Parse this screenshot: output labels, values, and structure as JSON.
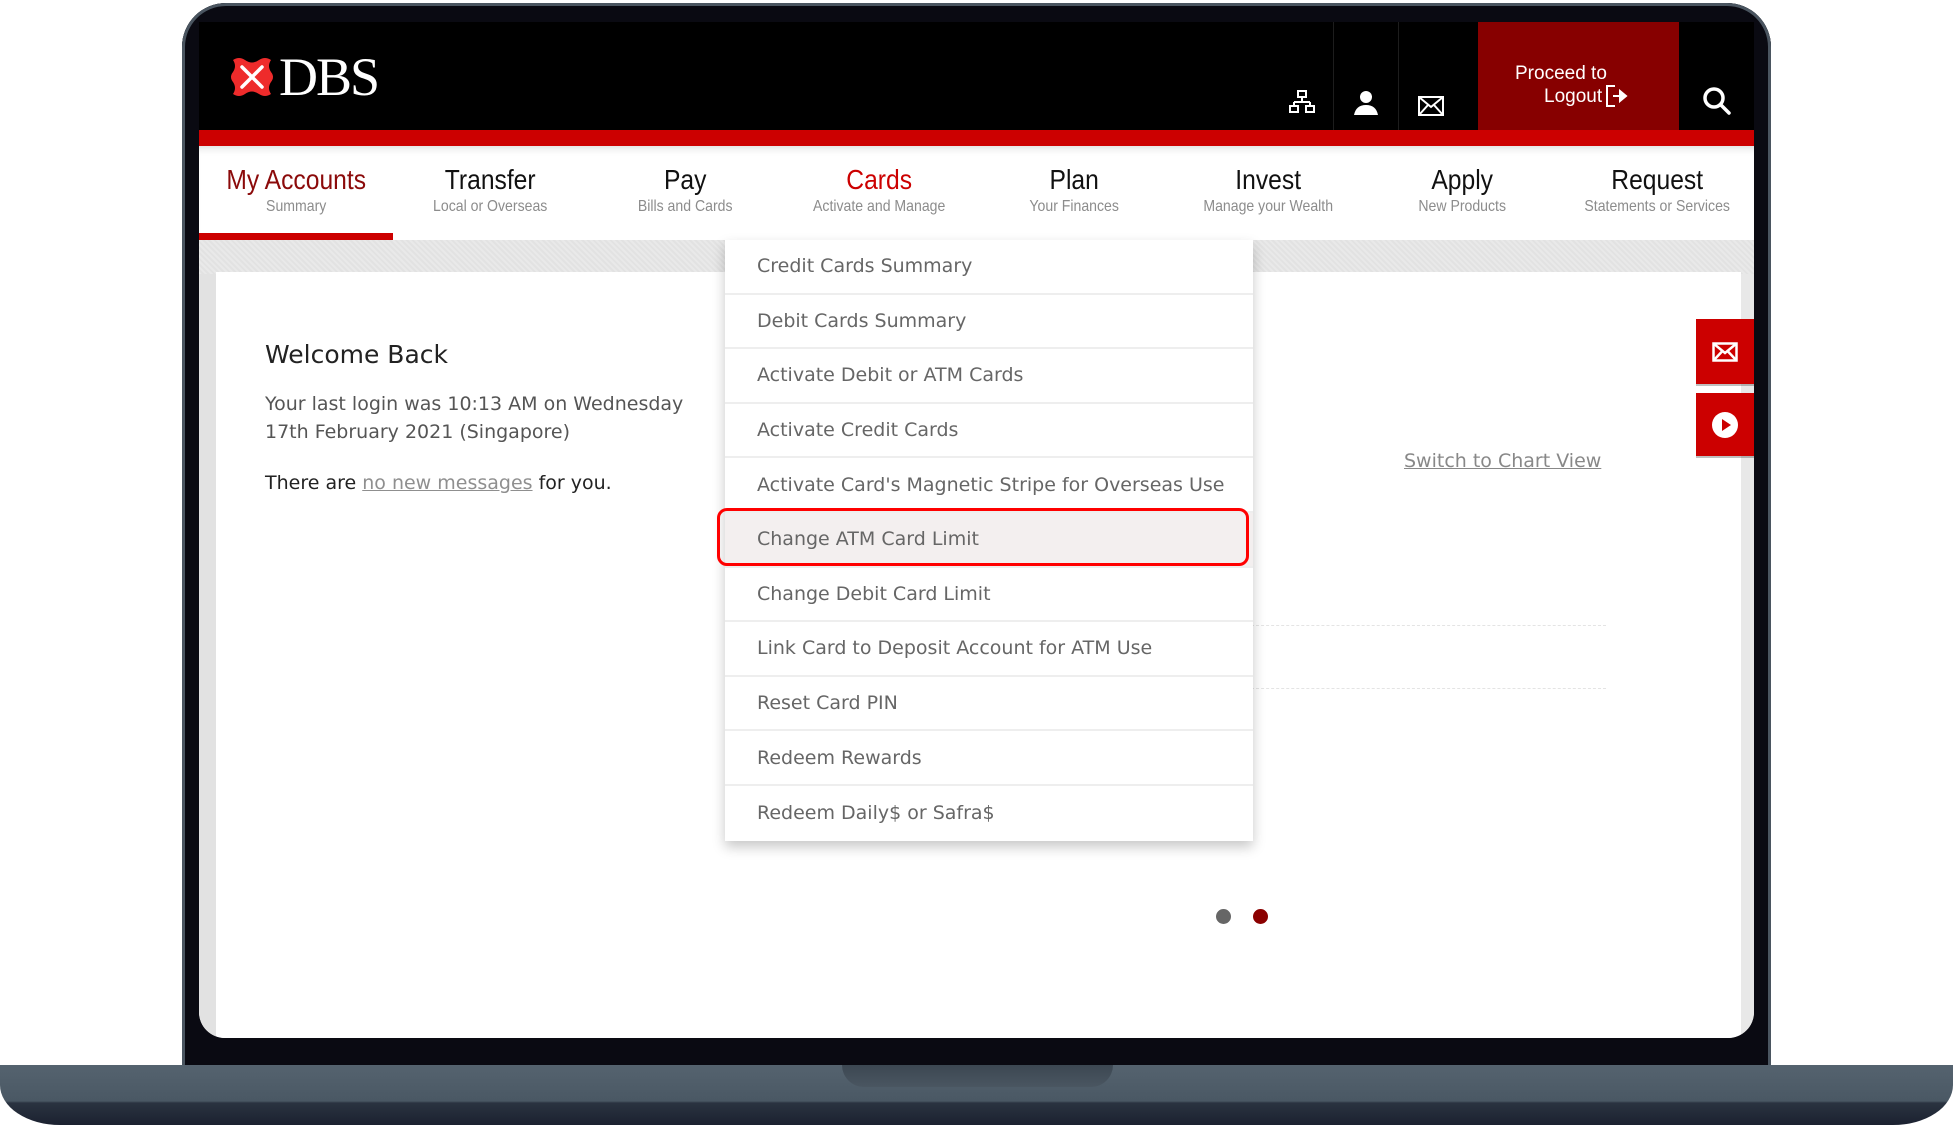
{
  "brand": {
    "name": "DBS",
    "accent": "#cc0000",
    "dark_red": "#870000"
  },
  "header": {
    "icons": [
      {
        "name": "sitemap-icon"
      },
      {
        "name": "user-icon"
      },
      {
        "name": "mail-icon"
      }
    ],
    "logout_line1": "Proceed to",
    "logout_line2": "Logout",
    "search_icon": "search-icon"
  },
  "nav": {
    "items": [
      {
        "title": "My Accounts",
        "subtitle": "Summary",
        "state": "active"
      },
      {
        "title": "Transfer",
        "subtitle": "Local or Overseas",
        "state": ""
      },
      {
        "title": "Pay",
        "subtitle": "Bills and Cards",
        "state": ""
      },
      {
        "title": "Cards",
        "subtitle": "Activate and Manage",
        "state": "open"
      },
      {
        "title": "Plan",
        "subtitle": "Your Finances",
        "state": ""
      },
      {
        "title": "Invest",
        "subtitle": "Manage your Wealth",
        "state": ""
      },
      {
        "title": "Apply",
        "subtitle": "New Products",
        "state": ""
      },
      {
        "title": "Request",
        "subtitle": "Statements or Services",
        "state": ""
      }
    ]
  },
  "cards_menu": {
    "items": [
      "Credit Cards Summary",
      "Debit Cards Summary",
      "Activate Debit or ATM Cards",
      "Activate Credit Cards",
      "Activate Card's Magnetic Stripe for Overseas Use",
      "Change ATM Card Limit",
      "Change Debit Card Limit",
      "Link Card to Deposit Account for ATM Use",
      "Reset Card PIN",
      "Redeem Rewards",
      "Redeem Daily$ or Safra$"
    ],
    "highlighted": "Change ATM Card Limit"
  },
  "welcome": {
    "title": "Welcome Back",
    "login_line1": "Your last login was 10:13 AM on Wednesday",
    "login_line2": "17th February 2021 (Singapore)",
    "messages_prefix": "There are ",
    "messages_link": "no new messages",
    "messages_suffix": " for you."
  },
  "main": {
    "chart_view_link": "Switch to Chart View"
  },
  "carousel": {
    "count": 2,
    "active_index": 1
  },
  "side_buttons": [
    {
      "name": "mail-icon"
    },
    {
      "name": "play-icon"
    }
  ]
}
